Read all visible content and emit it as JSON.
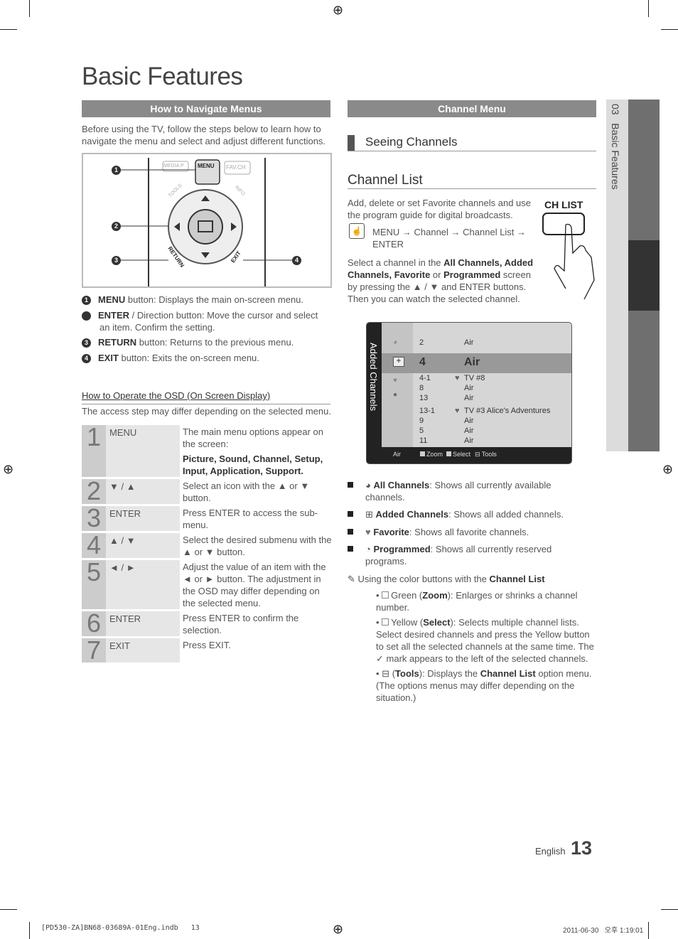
{
  "page_title": "Basic Features",
  "left": {
    "nav_header": "How to Navigate Menus",
    "intro": "Before using the TV, follow the steps below to learn how to navigate the menu and select and adjust different functions.",
    "remote_labels": {
      "media": "MEDIA.P",
      "menu": "MENU",
      "fav": "FAV.CH",
      "tools": "TOOLS",
      "info": "INFO",
      "return": "RETURN",
      "exit": "EXIT"
    },
    "callouts": [
      "1",
      "2",
      "3",
      "4"
    ],
    "legend": [
      {
        "key": "MENU",
        "text": " button: Displays the main on-screen menu."
      },
      {
        "key": "ENTER",
        "text": " / Direction button: Move the cursor and select an item. Confirm the setting."
      },
      {
        "key": "RETURN",
        "text": " button: Returns to the previous menu."
      },
      {
        "key": "EXIT",
        "text": " button: Exits the on-screen menu."
      }
    ],
    "osd_title": "How to Operate the OSD (On Screen Display)",
    "osd_sub": "The access step may differ depending on the selected menu.",
    "osd_rows": [
      {
        "n": "1",
        "key": "MENU",
        "desc": "The main menu options appear on the screen:",
        "bold": "Picture, Sound, Channel, Setup, Input, Application, Support."
      },
      {
        "n": "2",
        "key": "▼ / ▲",
        "desc": "Select an icon with the ▲ or ▼ button."
      },
      {
        "n": "3",
        "key": "ENTER",
        "desc": "Press ENTER to access the sub-menu."
      },
      {
        "n": "4",
        "key": "▲ / ▼",
        "desc": "Select the desired submenu with the ▲ or ▼ button."
      },
      {
        "n": "5",
        "key": "◄ / ►",
        "desc": "Adjust the value of an item with the ◄ or ► button. The adjustment in the OSD may differ depending on the selected menu."
      },
      {
        "n": "6",
        "key": "ENTER",
        "desc": "Press ENTER to confirm the selection."
      },
      {
        "n": "7",
        "key": "EXIT",
        "desc": "Press EXIT."
      }
    ]
  },
  "right": {
    "header": "Channel Menu",
    "section": "Seeing Channels",
    "subsection": "Channel List",
    "intro": "Add, delete or set Favorite channels and use the program guide for digital broadcasts.",
    "ch_list_label": "CH LIST",
    "path": "MENU → Channel → Channel List → ENTER",
    "select_text": {
      "a": "Select a channel in the ",
      "b": "All Channels, Added Channels, Favorite",
      "c": " or ",
      "d": "Programmed",
      "e": " screen by pressing the ▲ / ▼ and ",
      "f": "ENTER",
      "g": " buttons. Then you can watch the selected channel."
    },
    "tv": {
      "side_title": "Added Channels",
      "rows": [
        {
          "num": "2",
          "name": "Air",
          "fav": false
        },
        {
          "num": "4",
          "name": "Air",
          "fav": false,
          "selected": true
        },
        {
          "num": "4-1",
          "name": "TV #8",
          "fav": true
        },
        {
          "num": "8",
          "name": "Air",
          "fav": false
        },
        {
          "num": "13",
          "name": "Air",
          "fav": false
        },
        {
          "num": "13-1",
          "name": "TV #3 Alice's Adventures",
          "fav": true
        },
        {
          "num": "9",
          "name": "Air",
          "fav": false
        },
        {
          "num": "5",
          "name": "Air",
          "fav": false
        },
        {
          "num": "11",
          "name": "Air",
          "fav": false
        }
      ],
      "footer": {
        "source": "Air",
        "b": "Zoom",
        "c": "Select",
        "tools": "Tools"
      }
    },
    "bullets": [
      {
        "title": "All Channels",
        "text": ": Shows all currently available channels."
      },
      {
        "title": "Added Channels",
        "text": ": Shows all added channels."
      },
      {
        "title": "Favorite",
        "text": ": Shows all favorite channels."
      },
      {
        "title": "Programmed",
        "text": ": Shows all currently reserved programs."
      }
    ],
    "note": {
      "a": "Using the color buttons with the ",
      "b": "Channel List"
    },
    "sub_bullets": [
      {
        "a": "Green (",
        "b": "Zoom",
        "c": "): Enlarges or shrinks a channel number."
      },
      {
        "a": "Yellow (",
        "b": "Select",
        "c": "): Selects multiple channel lists. Select desired channels and press the Yellow button to set all the selected channels at the same time. The ✓ mark appears to the left of the selected channels."
      },
      {
        "a": "(",
        "b": "Tools",
        "c": "): Displays the ",
        "d": "Channel List",
        "e": " option menu. (The options menus may differ depending on the situation.)"
      }
    ]
  },
  "side_tab": {
    "number": "03",
    "label": "Basic Features"
  },
  "footer": {
    "lang": "English",
    "page": "13",
    "file": "[PD530-ZA]BN68-03689A-01Eng.indb   13",
    "date": "2011-06-30   오후 1:19:01"
  },
  "colors": {
    "header_bar": "#8a8a8a",
    "tab_dark": "#333333",
    "tab_mid": "#6f6f6f",
    "tab_light": "#dcdcdc"
  }
}
